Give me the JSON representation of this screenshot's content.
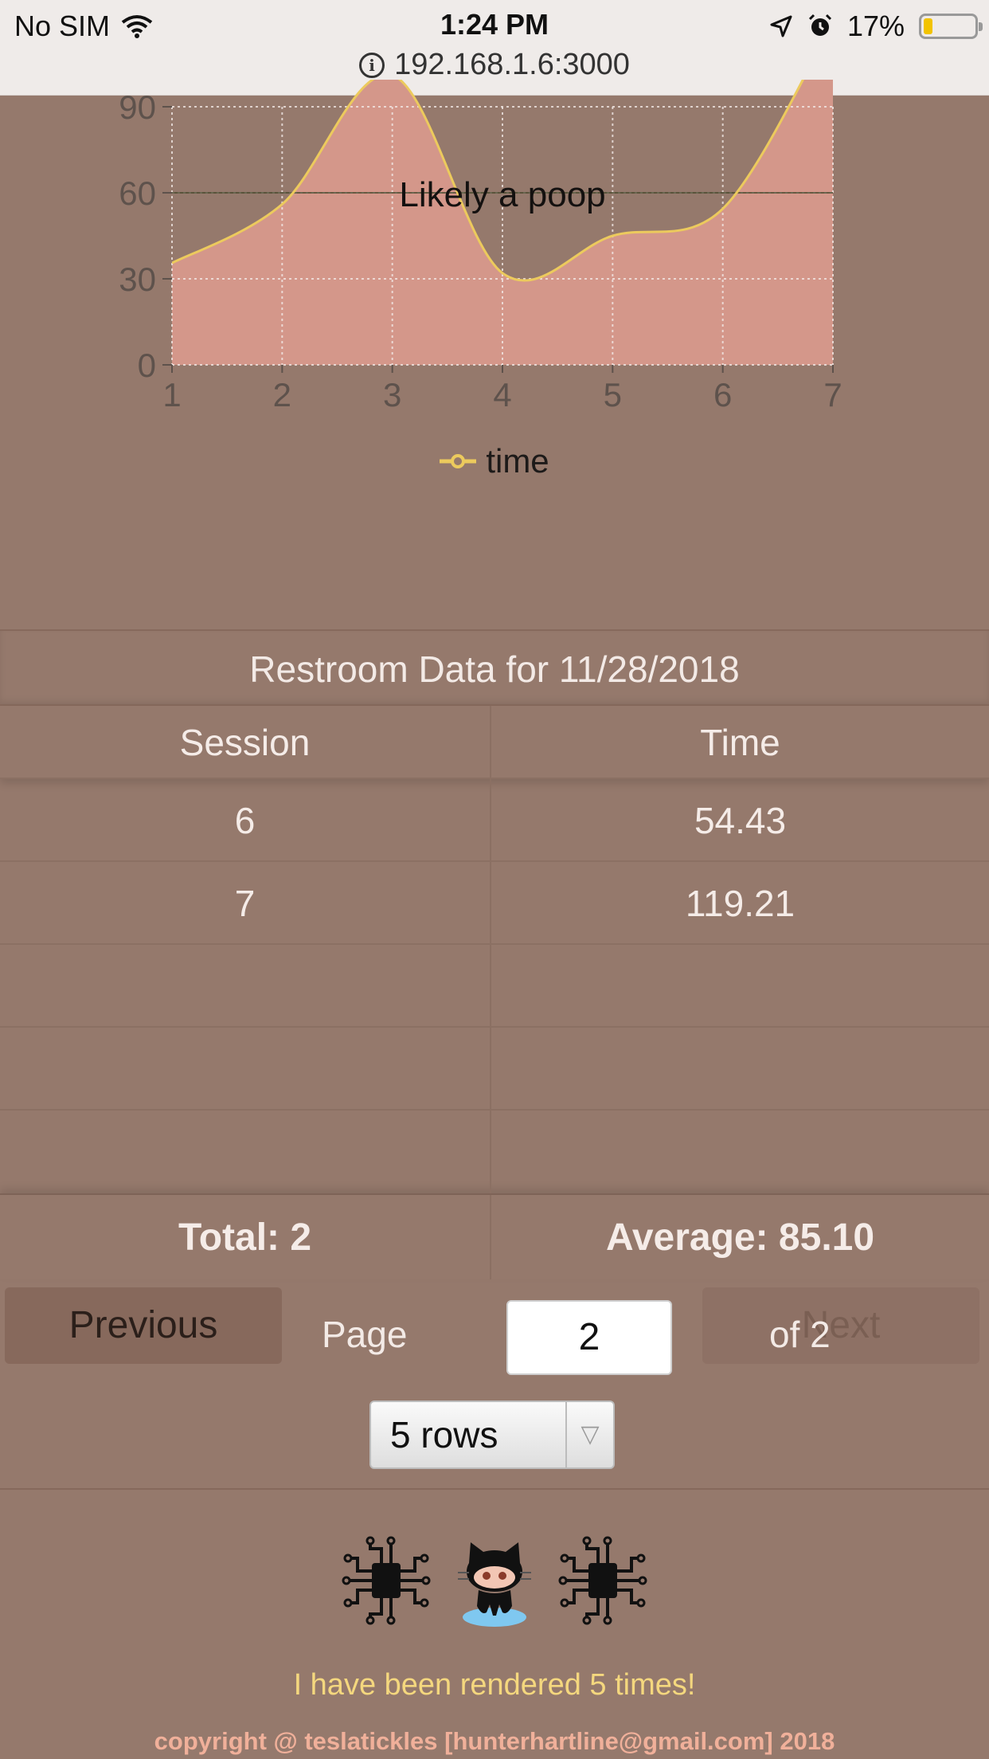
{
  "status_bar": {
    "carrier": "No SIM",
    "time": "1:24 PM",
    "battery_percent": "17%",
    "battery_level": 0.17
  },
  "url_bar": {
    "address": "192.168.1.6:3000"
  },
  "chart": {
    "annotation": "Likely a poop",
    "legend": "time",
    "series_color": "#ecca5d",
    "fill_color": "#d4978a"
  },
  "chart_data": {
    "type": "area",
    "x": [
      1,
      2,
      3,
      4,
      5,
      6,
      7
    ],
    "series": [
      {
        "name": "time",
        "values": [
          35.5,
          56,
          101,
          32,
          45,
          54.43,
          119.21
        ]
      }
    ],
    "xlim": [
      1,
      7
    ],
    "ylim": [
      0,
      90
    ],
    "yticks": [
      0,
      30,
      60,
      90
    ],
    "xticks": [
      1,
      2,
      3,
      4,
      5,
      6,
      7
    ],
    "reference_line": {
      "y": 60,
      "label": "Likely a poop"
    },
    "grid": true,
    "legend_position": "bottom"
  },
  "table": {
    "caption": "Restroom Data for 11/28/2018",
    "columns": [
      "Session",
      "Time"
    ],
    "rows": [
      {
        "session": "6",
        "time": "54.43"
      },
      {
        "session": "7",
        "time": "119.21"
      }
    ],
    "footer": {
      "total": "Total: 2",
      "average": "Average: 85.10"
    }
  },
  "pagination": {
    "previous_label": "Previous",
    "next_label": "Next",
    "page_label": "Page",
    "current_page": "2",
    "of_total": "of 2",
    "rows_option": "5 rows"
  },
  "footer": {
    "rendered_text": "I have been rendered 5 times!",
    "copyright": "copyright @ teslatickles [hunterhartline@gmail.com] 2018"
  }
}
